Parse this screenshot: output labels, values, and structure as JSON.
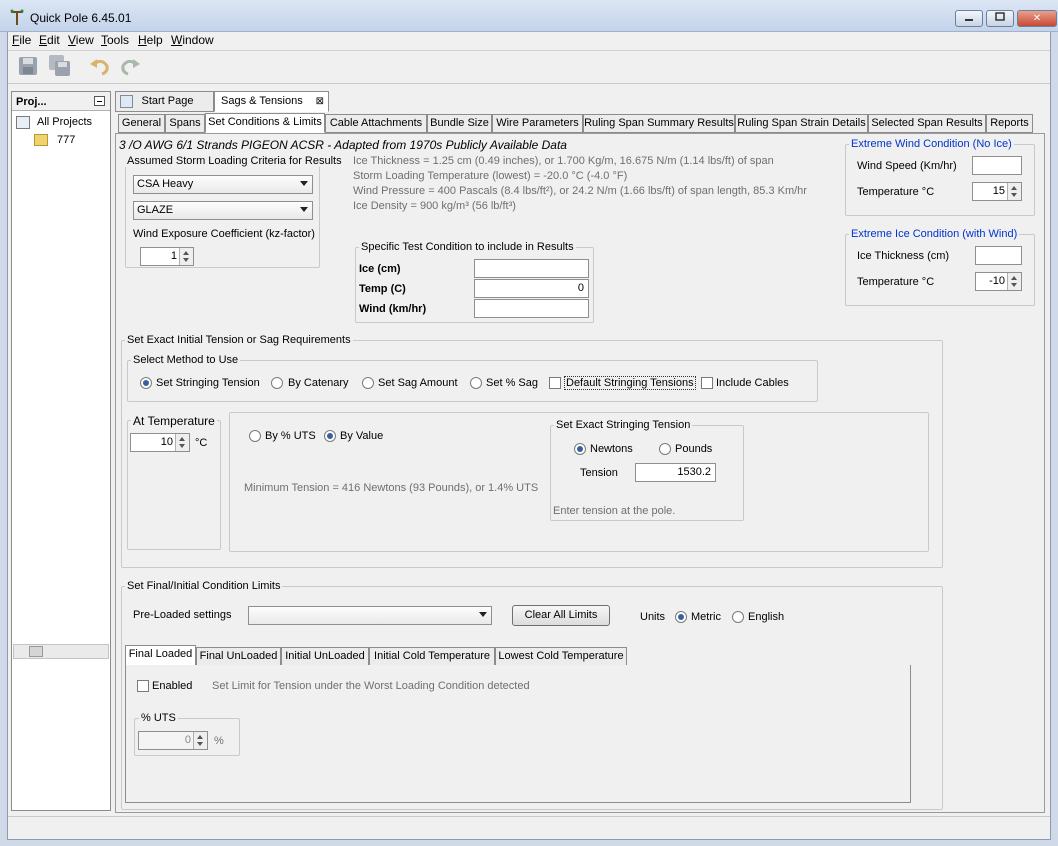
{
  "window": {
    "title": "Quick Pole 6.45.01",
    "min_icon": "minimize-icon",
    "max_icon": "maximize-icon",
    "close_glyph": "✕"
  },
  "menu": [
    {
      "label": "File",
      "key": "F",
      "rest": "ile"
    },
    {
      "label": "Edit",
      "key": "E",
      "rest": "dit"
    },
    {
      "label": "View",
      "key": "V",
      "rest": "iew"
    },
    {
      "label": "Tools",
      "key": "T",
      "rest": "ools"
    },
    {
      "label": "Help",
      "key": "H",
      "rest": "elp"
    },
    {
      "label": "Window",
      "key": "W",
      "rest": "indow"
    }
  ],
  "toolbar": {
    "icons": [
      "save-icon",
      "save-all-icon",
      "undo-icon",
      "redo-icon"
    ]
  },
  "projects": {
    "header": "Proj...",
    "root": "All Projects",
    "child": "777"
  },
  "doc_tabs": [
    {
      "label": "Start Page"
    },
    {
      "label": "Sags & Tensions",
      "close": "⊠"
    }
  ],
  "sub_tabs": [
    "General",
    "Spans",
    "Set Conditions & Limits",
    "Cable Attachments",
    "Bundle Size",
    "Wire Parameters",
    "Ruling Span Summary Results",
    "Ruling Span Strain Details",
    "Selected Span Results",
    "Reports"
  ],
  "conductor_title": "3 /O AWG 6/1 Strands PIGEON ACSR - Adapted from 1970s Publicly Available Data",
  "storm": {
    "label": "Assumed Storm Loading Criteria for Results",
    "combo1": "CSA Heavy",
    "combo2": "GLAZE",
    "kz_label": "Wind Exposure Coefficient (kz-factor)",
    "kz_value": "1"
  },
  "info_lines": [
    "Ice Thickness = 1.25 cm (0.49 inches), or 1.700 Kg/m, 16.675 N/m (1.14 lbs/ft) of span",
    "Storm Loading Temperature (lowest) = -20.0 °C (-4.0 °F)",
    "Wind Pressure = 400 Pascals (8.4 lbs/ft²), or 24.2 N/m (1.66 lbs/ft) of span length, 85.3 Km/hr",
    "Ice Density = 900 kg/m³ (56 lb/ft³)"
  ],
  "test_condition": {
    "label": "Specific Test Condition to include in Results",
    "ice_label": "Ice (cm)",
    "ice_value": "",
    "temp_label": "Temp (C)",
    "temp_value": "0",
    "wind_label": "Wind (km/hr)",
    "wind_value": ""
  },
  "extreme_wind": {
    "label": "Extreme Wind Condition (No Ice)",
    "speed_label": "Wind Speed (Km/hr)",
    "speed_value": "",
    "temp_label": "Temperature °C",
    "temp_value": "15"
  },
  "extreme_ice": {
    "label": "Extreme Ice Condition (with Wind)",
    "thick_label": "Ice Thickness (cm)",
    "thick_value": "",
    "temp_label": "Temperature °C",
    "temp_value": "-10"
  },
  "tension": {
    "label": "Set Exact Initial Tension or Sag Requirements",
    "method_label": "Select Method to Use",
    "methods": [
      "Set Stringing Tension",
      "By Catenary",
      "Set Sag Amount",
      "Set % Sag"
    ],
    "default_stringing": "Default Stringing Tensions",
    "include_cables": "Include Cables",
    "at_temp_label": "At Temperature",
    "at_temp_value": "10",
    "at_temp_unit": "°C",
    "by_uts": "By % UTS",
    "by_value": "By Value",
    "min_tension": "Minimum Tension = 416 Newtons (93 Pounds), or 1.4% UTS",
    "exact_label": "Set Exact Stringing Tension",
    "newtons": "Newtons",
    "pounds": "Pounds",
    "tension_label": "Tension",
    "tension_value": "1530.2",
    "hint": "Enter tension at the pole."
  },
  "limits": {
    "label": "Set Final/Initial Condition Limits",
    "preloaded_label": "Pre-Loaded settings",
    "preloaded_value": "",
    "clear_button": "Clear All Limits",
    "units_label": "Units",
    "metric": "Metric",
    "english": "English",
    "tabs": [
      "Final Loaded",
      "Final UnLoaded",
      "Initial UnLoaded",
      "Initial Cold Temperature",
      "Lowest Cold Temperature"
    ],
    "enabled_label": "Enabled",
    "limit_text": "Set Limit for Tension under the Worst Loading Condition detected",
    "uts_label": "% UTS",
    "uts_value": "0",
    "uts_unit": "%"
  }
}
